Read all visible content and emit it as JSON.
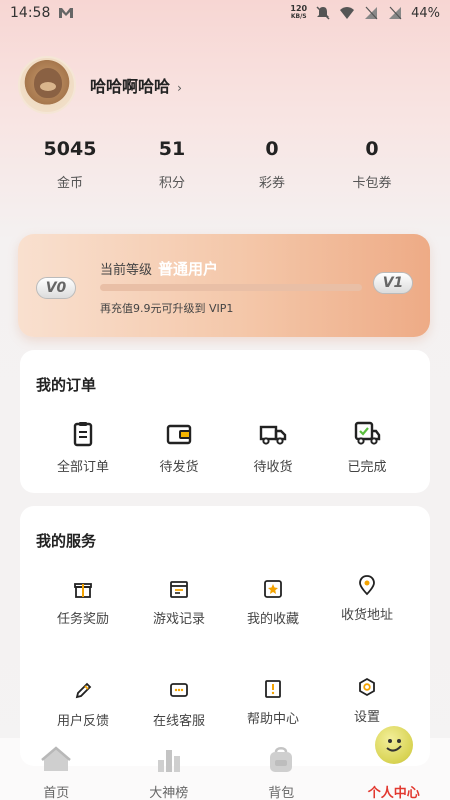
{
  "status": {
    "time": "14:58",
    "speed_value": "120",
    "speed_unit": "KB/S",
    "battery": "44%"
  },
  "profile": {
    "username": "哈哈啊哈哈",
    "chevron": "›"
  },
  "stats": [
    {
      "value": "5045",
      "label": "金币"
    },
    {
      "value": "51",
      "label": "积分"
    },
    {
      "value": "0",
      "label": "彩券"
    },
    {
      "value": "0",
      "label": "卡包券"
    }
  ],
  "vip": {
    "current_label": "当前等级",
    "level": "普通用户",
    "badge_current": "V0",
    "badge_next": "V1",
    "progress": 0,
    "hint": "再充值9.9元可升级到 VIP1"
  },
  "orders": {
    "title": "我的订单",
    "items": [
      {
        "label": "全部订单",
        "icon": "clipboard-icon"
      },
      {
        "label": "待发货",
        "icon": "wallet-icon"
      },
      {
        "label": "待收货",
        "icon": "truck-icon"
      },
      {
        "label": "已完成",
        "icon": "truck-check-icon"
      }
    ]
  },
  "services": {
    "title": "我的服务",
    "items": [
      {
        "label": "任务奖励",
        "icon": "gift-icon"
      },
      {
        "label": "游戏记录",
        "icon": "calendar-icon"
      },
      {
        "label": "我的收藏",
        "icon": "star-icon"
      },
      {
        "label": "收货地址",
        "icon": "location-pin-icon"
      },
      {
        "label": "用户反馈",
        "icon": "pencil-icon"
      },
      {
        "label": "在线客服",
        "icon": "chat-icon"
      },
      {
        "label": "帮助中心",
        "icon": "help-icon"
      },
      {
        "label": "设置",
        "icon": "settings-icon"
      }
    ]
  },
  "tabs": [
    {
      "label": "首页",
      "icon": "home-icon"
    },
    {
      "label": "大神榜",
      "icon": "ranking-icon"
    },
    {
      "label": "背包",
      "icon": "backpack-icon"
    },
    {
      "label": "个人中心",
      "icon": "smiley-icon",
      "active": true
    }
  ],
  "colors": {
    "accent": "#e2382f",
    "vip_gradient_end": "#eeab86"
  }
}
